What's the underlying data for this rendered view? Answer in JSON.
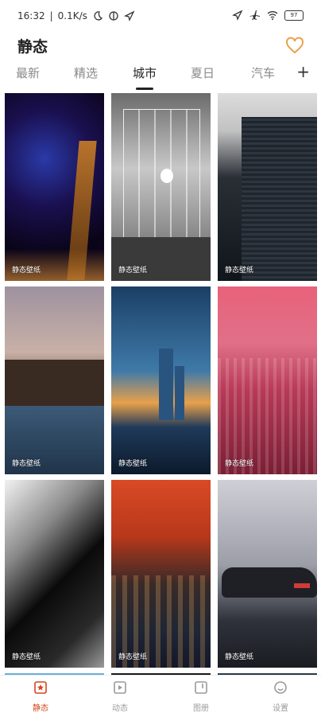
{
  "status": {
    "time": "16:32",
    "speed": "0.1K/s",
    "battery": "97"
  },
  "title": "静态",
  "tabs": [
    "最新",
    "精选",
    "城市",
    "夏日",
    "汽车"
  ],
  "add_label": "+",
  "tile_label": "静态壁纸",
  "nav": [
    "静态",
    "动态",
    "图册",
    "设置"
  ],
  "colors": {
    "accent": "#d4461f",
    "heart": "#e8a24a"
  }
}
